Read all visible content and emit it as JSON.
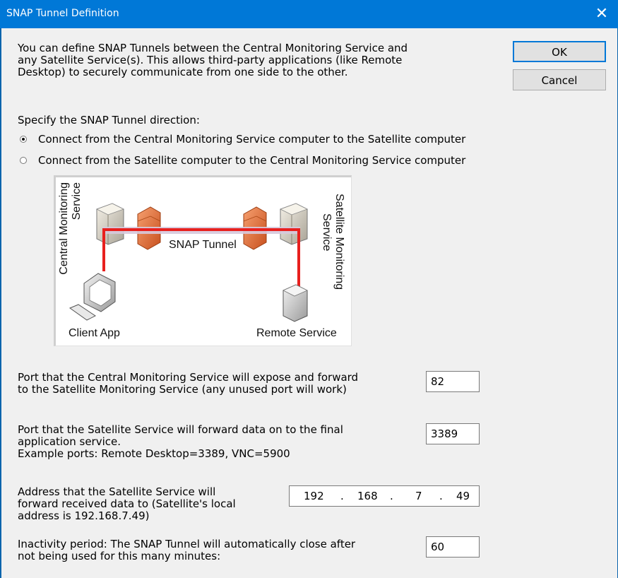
{
  "window": {
    "title": "SNAP Tunnel Definition",
    "close_glyph": "✕"
  },
  "intro": "You can define SNAP Tunnels between the Central Monitoring Service and\nany Satellite Service(s).  This allows third-party applications (like Remote\nDesktop) to securely communicate from one side to the other.",
  "buttons": {
    "ok": "OK",
    "cancel": "Cancel"
  },
  "direction": {
    "heading": "Specify the SNAP Tunnel direction:",
    "options": [
      {
        "label": "Connect from the Central Monitoring Service computer to the Satellite computer",
        "selected": true
      },
      {
        "label": "Connect from the Satellite computer to the Central Monitoring Service computer",
        "selected": false
      }
    ]
  },
  "diagram": {
    "central_label": "Central Monitoring\nService",
    "satellite_label": "Satellite Monitoring\nService",
    "tunnel_label": "SNAP Tunnel",
    "client_label": "Client App",
    "remote_label": "Remote Service",
    "arrow_color": "#e8201e",
    "icons": [
      "server-icon",
      "firewall-icon",
      "monitor-icon",
      "keyboard-icon",
      "remote-server-icon"
    ]
  },
  "fields": {
    "expose_port": {
      "label": "Port that the Central Monitoring Service will expose and forward\nto the Satellite Monitoring Service (any unused port will work)",
      "value": "82"
    },
    "forward_port": {
      "label": "Port that the Satellite Service will forward data on to the final\napplication service.\nExample ports: Remote Desktop=3389, VNC=5900",
      "value": "3389"
    },
    "address": {
      "label": "Address that the Satellite Service will\nforward received data to  (Satellite's local\naddress is 192.168.7.49)",
      "octets": [
        "192",
        "168",
        "7",
        "49"
      ],
      "dot": "."
    },
    "inactivity": {
      "label": "Inactivity period: The SNAP Tunnel will automatically close after\nnot being used for this many minutes:",
      "value": "60"
    }
  },
  "colors": {
    "titlebar": "#0078d7",
    "background": "#f0f0f0"
  }
}
